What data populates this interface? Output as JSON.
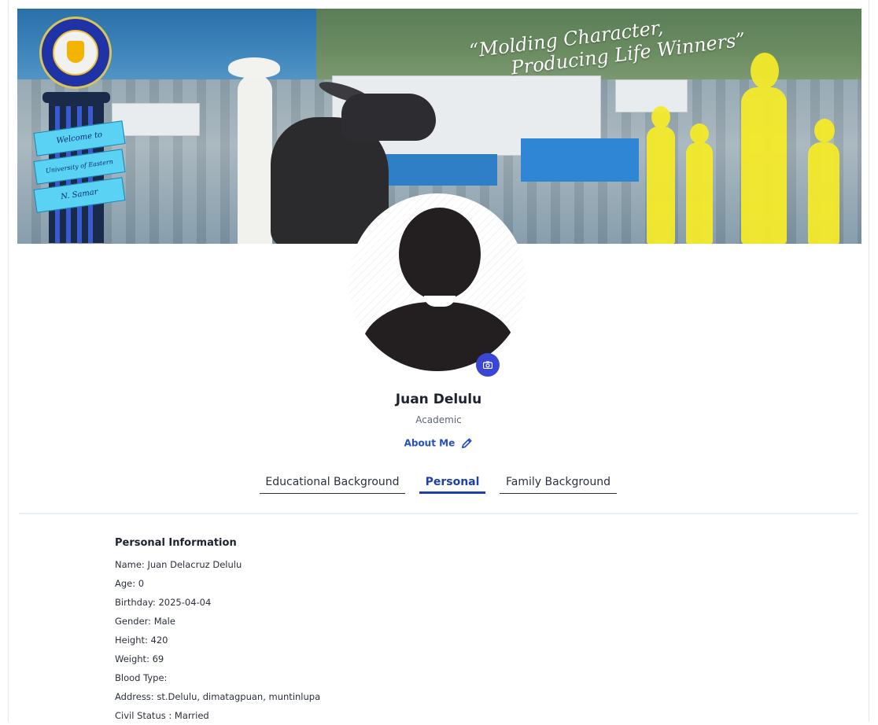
{
  "banner": {
    "motto_line1": "“Molding Character,",
    "motto_line2": "Producing Life Winners”",
    "ribbon_1": "Welcome to",
    "ribbon_2": "University of Eastern Philippines",
    "ribbon_3": "N. Samar"
  },
  "profile": {
    "name": "Juan Delulu",
    "role": "Academic",
    "about_label": "About Me"
  },
  "tabs": [
    {
      "label": "Educational Background",
      "active": false
    },
    {
      "label": "Personal",
      "active": true
    },
    {
      "label": "Family Background",
      "active": false
    }
  ],
  "personal": {
    "heading": "Personal Information",
    "rows": [
      "Name: Juan Delacruz Delulu",
      "Age: 0",
      "Birthday: 2025-04-04",
      "Gender: Male",
      "Height: 420",
      "Weight: 69",
      "Blood Type:",
      "Address: st.Delulu, dimatagpuan, muntinlupa",
      "Civil Status : Married"
    ]
  },
  "colors": {
    "accent": "#1e3fae",
    "camera_button": "#3b47d4",
    "link": "#2450c4"
  },
  "icons": {
    "camera": "camera-icon",
    "edit": "pencil-icon"
  }
}
